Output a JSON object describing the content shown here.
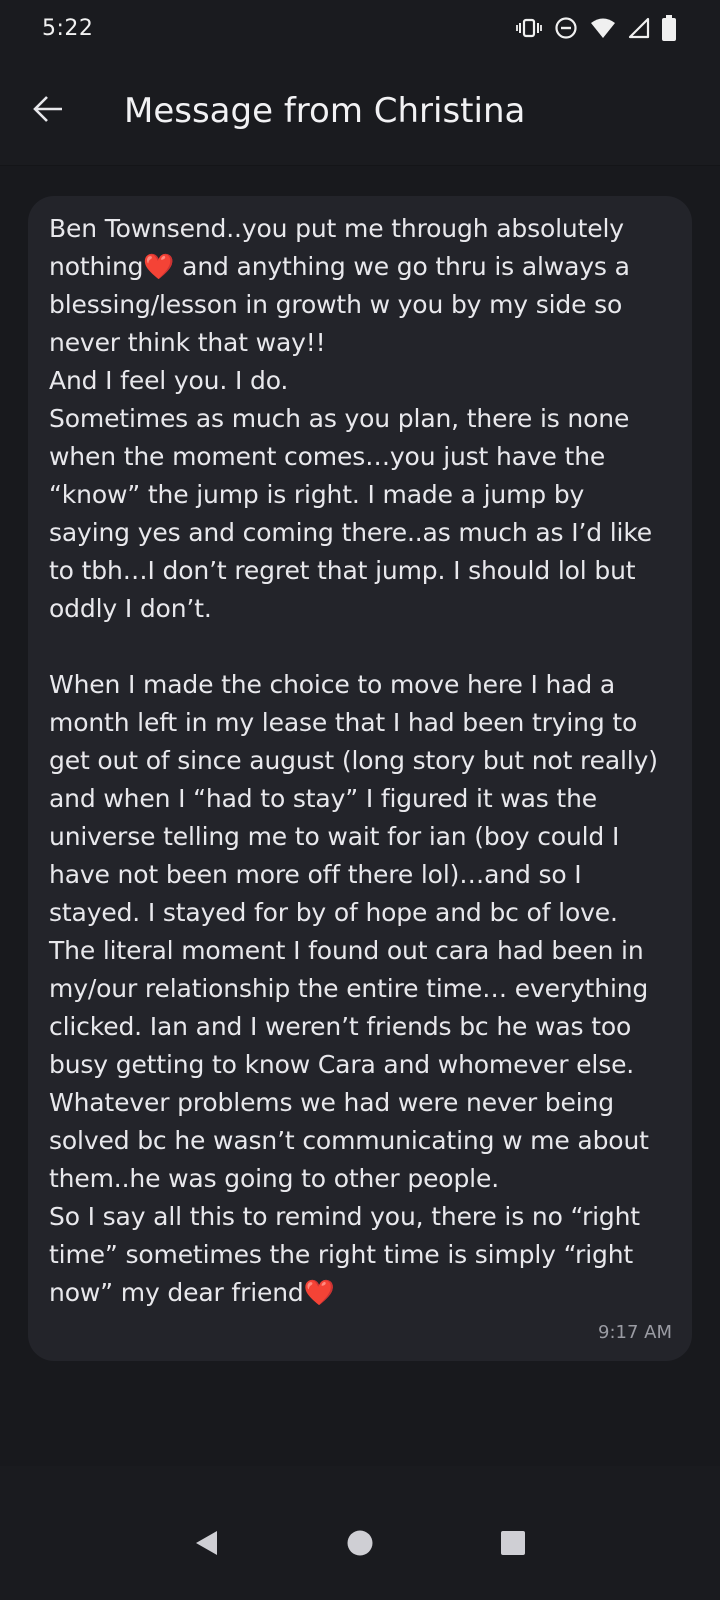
{
  "status_bar": {
    "time": "5:22",
    "icons": [
      "vibrate-icon",
      "do-not-disturb-icon",
      "wifi-icon",
      "cellular-icon",
      "battery-icon"
    ]
  },
  "app_bar": {
    "back_icon": "arrow-left-icon",
    "title": "Message from Christina"
  },
  "message": {
    "text": "Ben Townsend..you put me through absolutely nothing❤️ and anything we go thru is always a blessing/lesson in growth w you by my side so never think that way!!\nAnd I feel you. I do.\nSometimes as much as you plan, there is none when the moment comes…you just have the “know” the jump is right. I made a jump by saying yes and coming there..as much as I’d like to tbh…I don’t regret that jump. I should lol but oddly I don’t.\n\nWhen I made the choice to move here I had a month left in my lease that I had been trying to get out of since august (long story but not really) and when I “had to stay” I figured it was the universe telling me to wait for ian (boy could I have not been more off there lol)…and so I stayed. I stayed for by of hope and bc of love. The literal moment I found out cara had been in my/our relationship the entire time… everything clicked. Ian and I weren’t friends bc he was too busy getting to know Cara and whomever else. Whatever problems we had were never being solved bc he wasn’t communicating w me about them..he was going to other people.\nSo I say all this to remind you, there is no “right time” sometimes the right time is simply “right now” my dear friend❤️",
    "time": "9:17 AM"
  },
  "nav_bar": {
    "icons": [
      "back-triangle-icon",
      "home-circle-icon",
      "recents-square-icon"
    ]
  },
  "colors": {
    "background": "#1a1b1f",
    "bubble": "#23242a",
    "text": "#e8e8ec",
    "timestamp": "#9a9ba3"
  }
}
